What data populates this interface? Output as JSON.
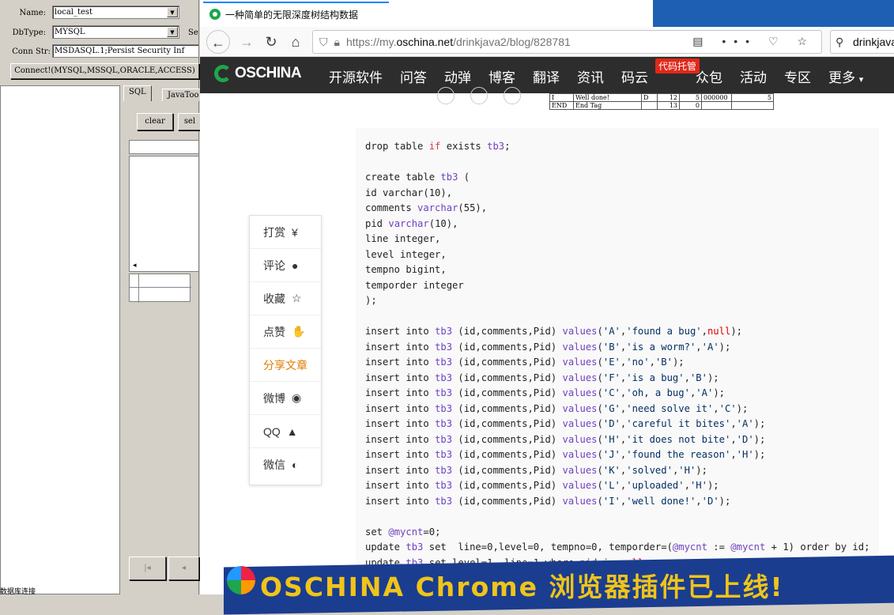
{
  "left_app": {
    "name_label": "Name:",
    "name_value": "local_test",
    "dbtype_label": "DbType:",
    "dbtype_value": "MYSQL",
    "dbtype_trailing": "Se",
    "connstr_label": "Conn Str:",
    "connstr_value": "MSDASQL.1;Persist Security Inf",
    "connect_button": "Connect!(MYSQL,MSSQL,ORACLE,ACCESS)",
    "tab_sql": "SQL",
    "tab_java": "JavaToo",
    "clear_button": "clear",
    "sel_button": "sel",
    "bottom_status": "数据库连接"
  },
  "browser": {
    "tab_title": "一种简单的无限深度树结构数据",
    "url_prefix": "https://my.",
    "url_host": "oschina.net",
    "url_path": "/drinkjava2/blog/828781",
    "search_value": "drinkjava",
    "page_actions": "•••"
  },
  "site": {
    "logo_text": "OSCHINA",
    "menu": [
      "开源软件",
      "问答",
      "动弹",
      "博客",
      "翻译",
      "资讯",
      "码云",
      "众包",
      "活动",
      "专区",
      "更多"
    ],
    "hot_badge": "代码托管"
  },
  "mini_table": {
    "rows": [
      [
        "I",
        "Well done!",
        "D",
        "12",
        "5",
        "000000",
        "5"
      ],
      [
        "END",
        "End Tag",
        "",
        "13",
        "0",
        "",
        ""
      ]
    ]
  },
  "share": {
    "items": [
      {
        "label": "打赏",
        "icon": "¥"
      },
      {
        "label": "评论",
        "icon": "●"
      },
      {
        "label": "收藏",
        "icon": "☆"
      },
      {
        "label": "点赞",
        "icon": "✋"
      },
      {
        "label": "分享文章",
        "icon": ""
      },
      {
        "label": "微博",
        "icon": "◉"
      },
      {
        "label": "QQ",
        "icon": "▲"
      },
      {
        "label": "微信",
        "icon": "◐"
      }
    ]
  },
  "code_lines": [
    "drop table if exists tb3;",
    "",
    "create table tb3 (",
    "id varchar(10),",
    "comments varchar(55),",
    "pid varchar(10),",
    "line integer,",
    "level integer,",
    "tempno bigint,",
    "temporder integer",
    ");",
    "",
    "insert into tb3 (id,comments,Pid) values('A','found a bug',null);",
    "insert into tb3 (id,comments,Pid) values('B','is a worm?','A');",
    "insert into tb3 (id,comments,Pid) values('E','no','B');",
    "insert into tb3 (id,comments,Pid) values('F','is a bug','B');",
    "insert into tb3 (id,comments,Pid) values('C','oh, a bug','A');",
    "insert into tb3 (id,comments,Pid) values('G','need solve it','C');",
    "insert into tb3 (id,comments,Pid) values('D','careful it bites','A');",
    "insert into tb3 (id,comments,Pid) values('H','it does not bite','D');",
    "insert into tb3 (id,comments,Pid) values('J','found the reason','H');",
    "insert into tb3 (id,comments,Pid) values('K','solved','H');",
    "insert into tb3 (id,comments,Pid) values('L','uploaded','H');",
    "insert into tb3 (id,comments,Pid) values('I','well done!','D');",
    "",
    "set @mycnt=0;",
    "update tb3 set  line=0,level=0, tempno=0, temporder=(@mycnt := @mycnt + 1) order by id;",
    "update tb3 set level=1, line=1 where pid is null;"
  ],
  "banner": {
    "text": "OSCHINA Chrome 浏览器插件已上线!"
  },
  "colors": {
    "accent": "#0a84ff",
    "site_header": "#2d2d2d",
    "brand_green": "#1ea64a",
    "badge_red": "#e0281a",
    "share_active": "#e07b00",
    "banner_bg": "#1b3d8f",
    "banner_text": "#f0c419"
  }
}
